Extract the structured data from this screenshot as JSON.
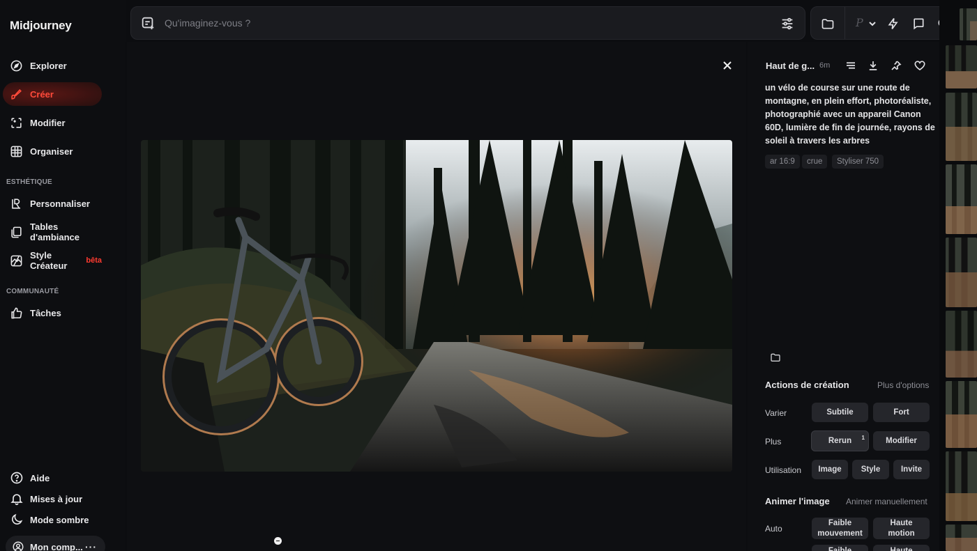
{
  "app": {
    "title": "Midjourney"
  },
  "sidebar": {
    "nav": [
      {
        "label": "Explorer",
        "icon": "compass-icon"
      },
      {
        "label": "Créer",
        "icon": "brush-icon"
      },
      {
        "label": "Modifier",
        "icon": "edit-frame-icon"
      },
      {
        "label": "Organiser",
        "icon": "grid-icon"
      }
    ],
    "aesthetics_label": "ESTHÉTIQUE",
    "aesthetics": [
      {
        "label": "Personnaliser",
        "icon": "personalize-icon"
      },
      {
        "label": "Tables d'ambiance",
        "icon": "moodboard-icon"
      },
      {
        "label": "Style Créateur",
        "icon": "style-creator-icon",
        "badge": "bêta"
      }
    ],
    "community_label": "COMMUNAUTÉ",
    "community": [
      {
        "label": "Tâches",
        "icon": "thumbs-up-icon"
      }
    ],
    "bottom": [
      {
        "label": "Aide",
        "icon": "help-icon"
      },
      {
        "label": "Mises à jour",
        "icon": "bell-icon"
      },
      {
        "label": "Mode sombre",
        "icon": "moon-icon"
      }
    ],
    "account": {
      "label": "Mon comp...",
      "more": "···"
    }
  },
  "search": {
    "placeholder": "Qu'imaginez-vous ?"
  },
  "toolbar": {
    "profile_letter": "P"
  },
  "detail": {
    "title": "Haut de g...",
    "time": "6m",
    "prompt": "un vélo de course sur une route de montagne, en plein effort, photoréaliste, photographié avec un appareil Canon 60D, lumière de fin de journée, rayons de soleil à travers les arbres",
    "chips": [
      "ar 16:9",
      "crue",
      "Styliser 750"
    ],
    "creation_actions": {
      "title": "Actions de création",
      "more": "Plus d'options",
      "rows": [
        {
          "label": "Varier",
          "buttons": [
            "Subtile",
            "Fort"
          ]
        },
        {
          "label": "Plus",
          "buttons": [
            "Rerun",
            "Modifier"
          ],
          "rerun_count": "1"
        },
        {
          "label": "Utilisation",
          "buttons": [
            "Image",
            "Style",
            "Invite"
          ]
        }
      ]
    },
    "animate": {
      "title": "Animer l'image",
      "manual": "Animer manuellement",
      "row_label": "Auto",
      "buttons": [
        "Faible mouvement",
        "Haute motion"
      ],
      "buttons_next": [
        "Faible",
        "Haute"
      ]
    }
  },
  "colors": {
    "accent": "#ff3b30",
    "background": "#0c0d10",
    "surface": "#1a1b1f"
  }
}
